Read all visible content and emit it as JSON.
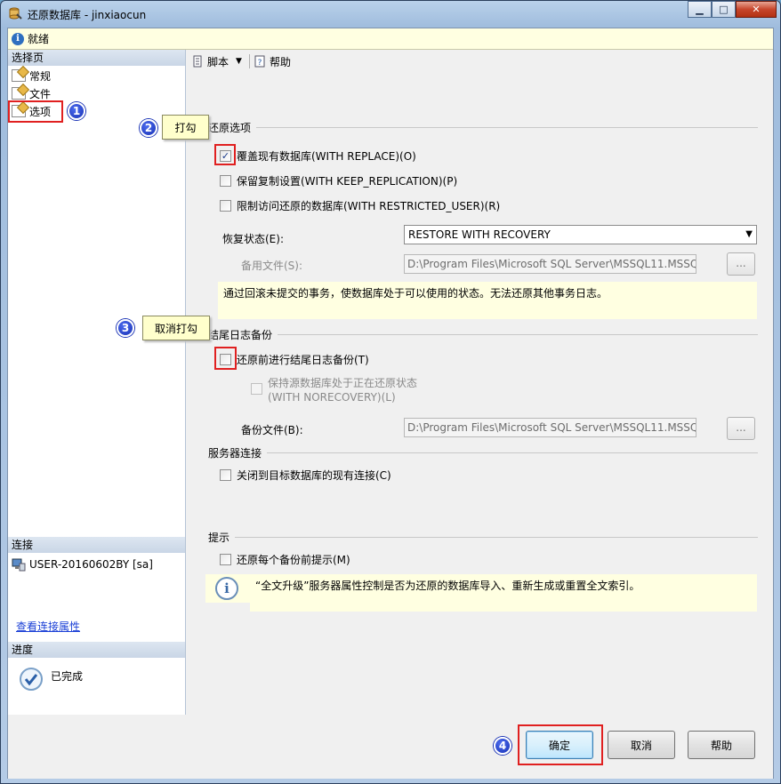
{
  "window": {
    "title": "还原数据库 - jinxiaocun"
  },
  "status": {
    "text": "就绪"
  },
  "left": {
    "select_page_header": "选择页",
    "pages": [
      {
        "label": "常规"
      },
      {
        "label": "文件"
      },
      {
        "label": "选项"
      }
    ],
    "connection_header": "连接",
    "connection_server": "USER-20160602BY [sa]",
    "view_connection_link": "查看连接属性",
    "progress_header": "进度",
    "progress_status": "已完成"
  },
  "toolbar": {
    "script_label": "脚本",
    "help_label": "帮助"
  },
  "restore_options": {
    "header": "还原选项",
    "overwrite": {
      "label": "覆盖现有数据库(WITH REPLACE)(O)",
      "checked": true
    },
    "keep_replication": {
      "label": "保留复制设置(WITH KEEP_REPLICATION)(P)",
      "checked": false
    },
    "restricted_user": {
      "label": "限制访问还原的数据库(WITH RESTRICTED_USER)(R)",
      "checked": false
    },
    "recovery_state_label": "恢复状态(E):",
    "recovery_state_value": "RESTORE WITH RECOVERY",
    "standby_file_label": "备用文件(S):",
    "standby_file_value": "D:\\Program Files\\Microsoft SQL Server\\MSSQL11.MSSQ",
    "browse_label": "...",
    "note": "通过回滚未提交的事务，使数据库处于可以使用的状态。无法还原其他事务日志。"
  },
  "tail_log": {
    "header": "结尾日志备份",
    "take_tail_log": {
      "label": "还原前进行结尾日志备份(T)",
      "checked": false
    },
    "leave_restoring_line1": "保持源数据库处于正在还原状态",
    "leave_restoring_line2": "(WITH NORECOVERY)(L)",
    "backup_file_label": "备份文件(B):",
    "backup_file_value": "D:\\Program Files\\Microsoft SQL Server\\MSSQL11.MSSQ",
    "browse_label": "..."
  },
  "server_connections": {
    "header": "服务器连接",
    "close_existing": {
      "label": "关闭到目标数据库的现有连接(C)",
      "checked": false
    }
  },
  "prompt": {
    "header": "提示",
    "prompt_before_each": {
      "label": "还原每个备份前提示(M)",
      "checked": false
    },
    "info": "“全文升级”服务器属性控制是否为还原的数据库导入、重新生成或重置全文索引。"
  },
  "annotations": {
    "badge1": "1",
    "badge2": "2",
    "badge3": "3",
    "badge4": "4",
    "callout_check": "打勾",
    "callout_uncheck": "取消打勾"
  },
  "buttons": {
    "ok": "确定",
    "cancel": "取消",
    "help": "帮助"
  },
  "icons": {
    "info": "info-icon",
    "check": "check-mark"
  }
}
